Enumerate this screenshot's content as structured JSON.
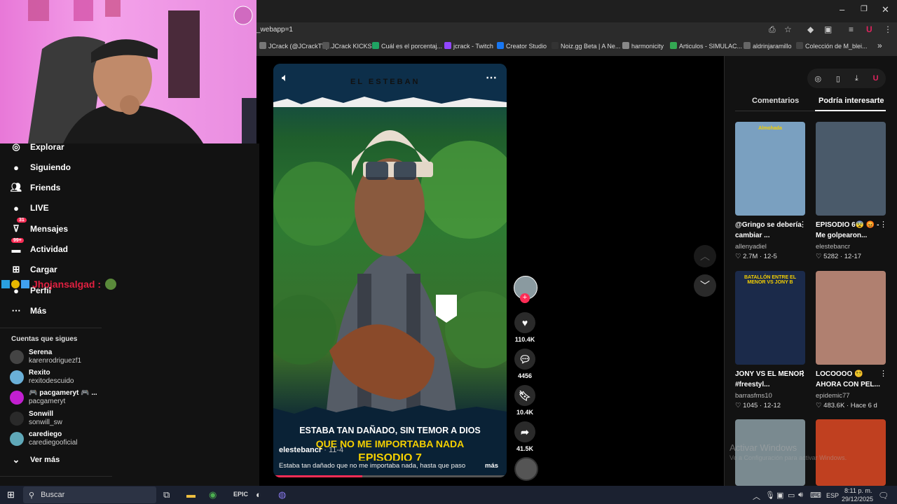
{
  "browser": {
    "url_fragment": "_webapp=1",
    "bookmarks": [
      {
        "label": "JCrack (@JCrackTV)...",
        "color": "#777"
      },
      {
        "label": "JCrack KICKS",
        "color": "#555"
      },
      {
        "label": "Cuál es el porcentaj...",
        "color": "#1fa463"
      },
      {
        "label": "jcrack - Twitch",
        "color": "#9146ff"
      },
      {
        "label": "Creator Studio",
        "color": "#1877f2"
      },
      {
        "label": "Noiz.gg Beta | A Ne...",
        "color": "#333"
      },
      {
        "label": "harmonicity",
        "color": "#888"
      },
      {
        "label": "Articulos - SIMULAC...",
        "color": "#34a853"
      },
      {
        "label": "aldrinjaramillo",
        "color": "#666"
      },
      {
        "label": "Colección de M_blei...",
        "color": "#444"
      }
    ],
    "more_bookmarks": "»"
  },
  "sidebar": {
    "nav": [
      {
        "label": "Explorar",
        "icon": "compass-icon"
      },
      {
        "label": "Siguiendo",
        "icon": "following-avatar-icon"
      },
      {
        "label": "Friends",
        "icon": "friends-icon"
      },
      {
        "label": "LIVE",
        "icon": "live-icon"
      },
      {
        "label": "Mensajes",
        "icon": "messages-icon",
        "badge": "31"
      },
      {
        "label": "Actividad",
        "icon": "activity-icon",
        "badge": "99+"
      },
      {
        "label": "Cargar",
        "icon": "upload-icon"
      },
      {
        "label": "Perfil",
        "icon": "profile-icon"
      },
      {
        "label": "Más",
        "icon": "more-icon"
      }
    ],
    "overlay_user": "Jhojansalgad :",
    "following_title": "Cuentas que sigues",
    "accounts": [
      {
        "name": "Serena",
        "user": "karenrodriguezf1",
        "color": "#444"
      },
      {
        "name": "Rexito",
        "user": "rexitodescuido",
        "color": "#6ab0d8"
      },
      {
        "name": "🎮 pacgameryt 🎮 ...",
        "user": "pacgameryt",
        "color": "#c21fd0"
      },
      {
        "name": "Sonwill",
        "user": "sonwill_sw",
        "color": "#2a2a2a"
      },
      {
        "name": "carediego",
        "user": "carediegooficial",
        "color": "#5fa8b8"
      }
    ],
    "see_more": "Ver más"
  },
  "video": {
    "brand": "EL ESTEBAN",
    "caption_line1": "ESTABA TAN DAÑADO, SIN TEMOR A DIOS",
    "caption_line2": "QUE NO ME IMPORTABA NADA",
    "caption_line3": "EPISODIO 7",
    "author": "elestebancr",
    "date": "· 11-4",
    "description": "Estaba tan dañado que no me importaba nada, hasta que paso",
    "more": "más",
    "progress": 0.38
  },
  "actions": {
    "likes": "110.4K",
    "comments": "4456",
    "saves": "10.4K",
    "shares": "41.5K"
  },
  "right_panel": {
    "tabs": [
      "Comentarios",
      "Podría interesarte"
    ],
    "active_tab": 1,
    "videos": [
      {
        "title": "@Gringo se debería cambiar ...",
        "user": "allenyadiel",
        "likes": "2.7M",
        "date": "12-5",
        "thumb_text": "Almohada",
        "color": "#7aa0c0"
      },
      {
        "title": "EPISODIO 6😨 😡 - Me golpearon...",
        "user": "elestebancr",
        "likes": "5282",
        "date": "12-17",
        "thumb_text": "",
        "color": "#4a5a6a"
      },
      {
        "title": "JONY VS EL MENOR #freestyl...",
        "user": "barrasfms10",
        "likes": "1045",
        "date": "12-12",
        "thumb_text": "BATALLÓN ENTRE EL MENOR VS JONY B",
        "color": "#1b2a4a"
      },
      {
        "title": "LOCOOOO 😵‍💫 AHORA CON PEL...",
        "user": "epidemic77",
        "likes": "483.6K",
        "date": "Hace 6 d",
        "thumb_text": "",
        "color": "#b08070"
      },
      {
        "title": "",
        "user": "",
        "likes": "",
        "date": "",
        "thumb_text": "",
        "color": "#7a8a90"
      },
      {
        "title": "",
        "user": "",
        "likes": "",
        "date": "",
        "thumb_text": "",
        "color": "#c04020"
      }
    ],
    "watermark1": "Activar Windows",
    "watermark2": "Ve a Configuración para activar Windows."
  },
  "taskbar": {
    "search_placeholder": "Buscar",
    "lang": "ESP",
    "time": "8:11 p. m.",
    "date": "29/12/2025"
  }
}
